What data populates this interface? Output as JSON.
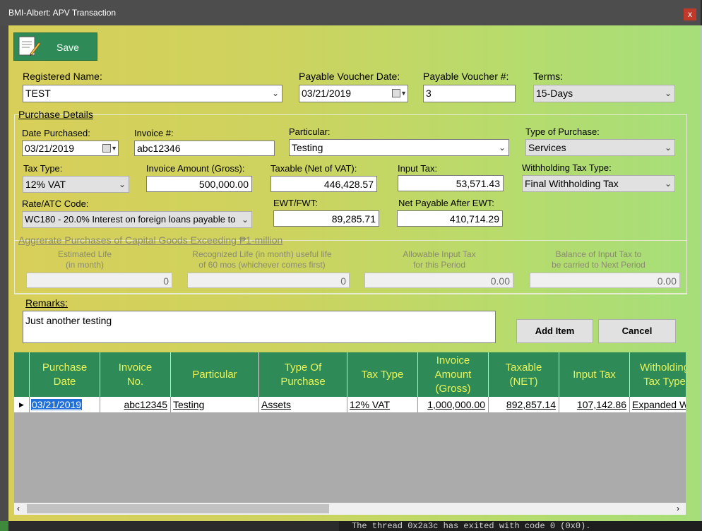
{
  "window": {
    "title": "BMI-Albert: APV Transaction",
    "close_glyph": "x"
  },
  "toolbar": {
    "save_label": "Save"
  },
  "header": {
    "registered_name_label": "Registered Name:",
    "registered_name_value": "TEST",
    "voucher_date_label": "Payable Voucher Date:",
    "voucher_date_value": "03/21/2019",
    "voucher_no_label": "Payable Voucher #:",
    "voucher_no_value": "3",
    "terms_label": "Terms:",
    "terms_value": "15-Days"
  },
  "purchase_details": {
    "title": "Purchase Details",
    "date_purchased_label": "Date Purchased:",
    "date_purchased_value": "03/21/2019",
    "invoice_no_label": "Invoice #:",
    "invoice_no_value": "abc12346",
    "particular_label": "Particular:",
    "particular_value": "Testing",
    "type_of_purchase_label": "Type of Purchase:",
    "type_of_purchase_value": "Services",
    "tax_type_label": "Tax Type:",
    "tax_type_value": "12% VAT",
    "invoice_amount_label": "Invoice Amount (Gross):",
    "invoice_amount_value": "500,000.00",
    "taxable_label": "Taxable (Net of VAT):",
    "taxable_value": "446,428.57",
    "input_tax_label": "Input Tax:",
    "input_tax_value": "53,571.43",
    "withholding_type_label": "Withholding Tax Type:",
    "withholding_type_value": "Final Withholding Tax",
    "rate_label": "Rate/ATC Code:",
    "rate_value": "WC180 - 20.0% Interest on foreign loans payable to",
    "ewt_label": "EWT/FWT:",
    "ewt_value": "89,285.71",
    "net_payable_label": "Net Payable After EWT:",
    "net_payable_value": "410,714.29"
  },
  "capital_goods": {
    "title": "Aggrerate Purchases of Capital Goods Exceeding ₱1-million",
    "est_life_label": "Estimated Life\n(in month)",
    "est_life_value": "0",
    "rec_life_label": "Recognized Life (in month) useful life\nof 60 mos (whichever comes first)",
    "rec_life_value": "0",
    "allowable_label": "Allowable Input Tax\nfor this Period",
    "allowable_value": "0.00",
    "balance_label": "Balance of Input Tax to\nbe carried to Next Period",
    "balance_value": "0.00"
  },
  "remarks": {
    "label": "Remarks:",
    "value": "Just another testing"
  },
  "actions": {
    "add_item_label": "Add Item",
    "cancel_label": "Cancel"
  },
  "grid": {
    "columns": [
      "Purchase\nDate",
      "Invoice\nNo.",
      "Particular",
      "Type Of\nPurchase",
      "Tax Type",
      "Invoice\nAmount\n(Gross)",
      "Taxable\n(NET)",
      "Input Tax",
      "Witholding\nTax Type"
    ],
    "rows": [
      {
        "date": "03/21/2019",
        "invoice": "abc12345",
        "particular": "Testing",
        "type": "Assets",
        "tax_type": "12% VAT",
        "amount": "1,000,000.00",
        "taxable": "892,857.14",
        "input_tax": "107,142.86",
        "withholding": "Expanded Withholding Tax"
      }
    ]
  },
  "console_text": "The thread 0x2a3c has exited with code 0 (0x0)."
}
